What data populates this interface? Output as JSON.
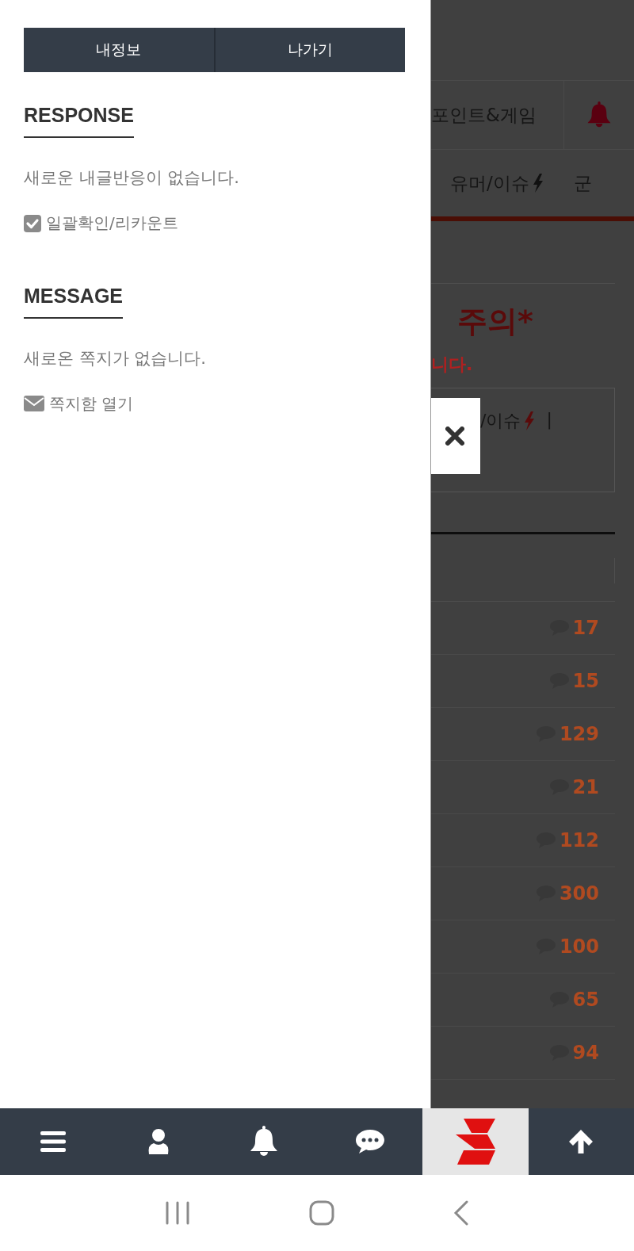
{
  "drawer": {
    "buttons": [
      "내정보",
      "나가기"
    ],
    "sections": [
      {
        "title": "RESPONSE",
        "message": "새로운 내글반응이 없습니다.",
        "action": {
          "kind": "check",
          "label": "일괄확인/리카운트"
        }
      },
      {
        "title": "MESSAGE",
        "message": "새로온 쪽지가 없습니다.",
        "action": {
          "kind": "mail",
          "label": "쪽지함 열기"
        }
      }
    ]
  },
  "background_page": {
    "top_menu": "포인트&게임",
    "category_tabs": [
      {
        "label": "유머/이슈",
        "kind": "bolt"
      },
      {
        "label": "군",
        "kind": "plain"
      }
    ],
    "notice_title": "주의*",
    "notice_text": "니다.",
    "notice_box": {
      "label": "/이슈",
      "separator": "|"
    },
    "comment_counts": [
      "17",
      "15",
      "129",
      "21",
      "112",
      "300",
      "100",
      "65",
      "94"
    ]
  },
  "bottom_nav": [
    {
      "kind": "menu"
    },
    {
      "kind": "user"
    },
    {
      "kind": "bell"
    },
    {
      "kind": "chat"
    },
    {
      "kind": "logo"
    },
    {
      "kind": "top"
    }
  ]
}
